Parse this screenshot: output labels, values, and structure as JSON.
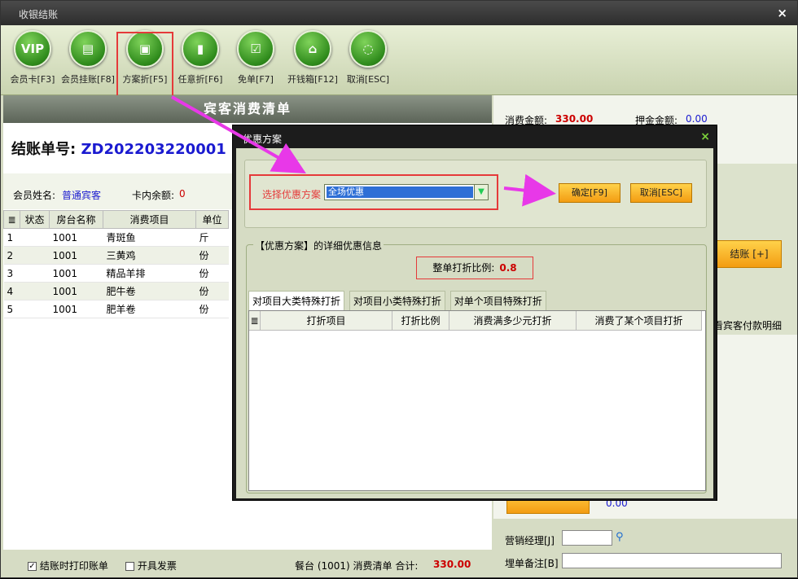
{
  "window": {
    "title": "收银结账",
    "close": "×"
  },
  "toolbar": [
    {
      "name": "vip-card-button",
      "icon": "VIP",
      "label": "会员卡[F3]"
    },
    {
      "name": "member-charge-button",
      "icon": "▤",
      "label": "会员挂账[F8]"
    },
    {
      "name": "plan-discount-button",
      "icon": "▣",
      "label": "方案折[F5]"
    },
    {
      "name": "custom-discount-button",
      "icon": "▮",
      "label": "任意折[F6]"
    },
    {
      "name": "free-order-button",
      "icon": "☑",
      "label": "免单[F7]"
    },
    {
      "name": "open-cashbox-button",
      "icon": "⌂",
      "label": "开钱箱[F12]"
    },
    {
      "name": "cancel-button",
      "icon": "◌",
      "label": "取消[ESC]"
    }
  ],
  "bill": {
    "header": "宾客消费清单",
    "bill_label": "结账单号:",
    "bill_no": "ZD202203220001",
    "member_label": "会员姓名:",
    "member_value": "普通宾客",
    "balance_label": "卡内余额:",
    "balance_value": "0",
    "columns": [
      "状态",
      "房台名称",
      "消费项目",
      "单位"
    ],
    "rows": [
      {
        "no": "1",
        "status": "",
        "room": "1001",
        "item": "青斑鱼",
        "unit": "斤"
      },
      {
        "no": "2",
        "status": "",
        "room": "1001",
        "item": "三黄鸡",
        "unit": "份"
      },
      {
        "no": "3",
        "status": "",
        "room": "1001",
        "item": "精品羊排",
        "unit": "份"
      },
      {
        "no": "4",
        "status": "",
        "room": "1001",
        "item": "肥牛卷",
        "unit": "份"
      },
      {
        "no": "5",
        "status": "",
        "room": "1001",
        "item": "肥羊卷",
        "unit": "份"
      }
    ],
    "footer": {
      "print_label": "结账时打印账单",
      "invoice_label": "开具发票",
      "summary": "餐台 (1001) 消费清单 合计:",
      "total": "330.00"
    }
  },
  "right": {
    "consume_label": "消费金额:",
    "consume_value": "330.00",
    "deposit_label": "押金金额:",
    "deposit_value": "0.00",
    "checkout_label": "结账 [+]",
    "payment_detail": "看宾客付款明细",
    "small_value": "0.00",
    "manager_label": "营销经理[J]",
    "remark_label": "埋单备注[B]"
  },
  "dialog": {
    "title": "优惠方案",
    "close": "×",
    "select_label": "选择优惠方案",
    "select_value": "全场优惠",
    "confirm": "确定[F9]",
    "cancel": "取消[ESC]",
    "detail_legend": "【优惠方案】的详细优惠信息",
    "ratio_label": "整单打折比例:",
    "ratio_value": "0.8",
    "tabs": [
      "对项目大类特殊打折",
      "对项目小类特殊打折",
      "对单个项目特殊打折"
    ],
    "table_headers": [
      "打折项目",
      "打折比例",
      "消费满多少元打折",
      "消费了某个项目打折"
    ]
  },
  "colors": {
    "accent_red": "#e53a3a",
    "arrow": "#e838e8",
    "orange": "#f39c12"
  }
}
